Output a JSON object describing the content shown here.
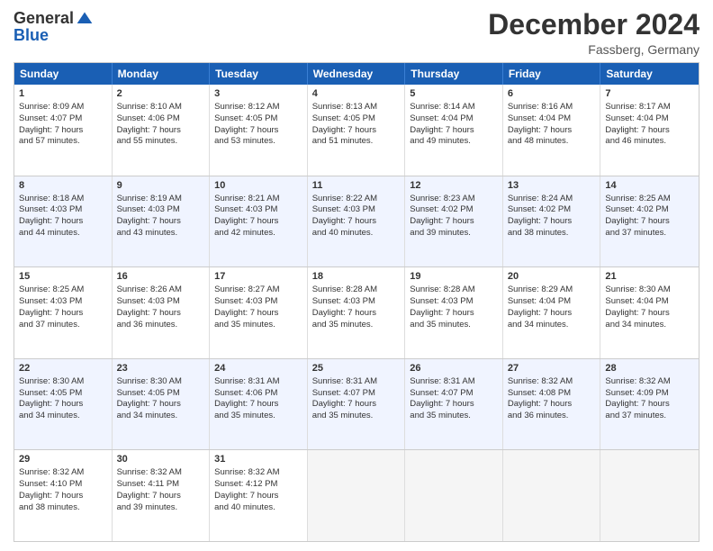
{
  "header": {
    "logo_general": "General",
    "logo_blue": "Blue",
    "month_title": "December 2024",
    "location": "Fassberg, Germany"
  },
  "weekdays": [
    "Sunday",
    "Monday",
    "Tuesday",
    "Wednesday",
    "Thursday",
    "Friday",
    "Saturday"
  ],
  "rows": [
    [
      {
        "day": "1",
        "lines": [
          "Sunrise: 8:09 AM",
          "Sunset: 4:07 PM",
          "Daylight: 7 hours",
          "and 57 minutes."
        ]
      },
      {
        "day": "2",
        "lines": [
          "Sunrise: 8:10 AM",
          "Sunset: 4:06 PM",
          "Daylight: 7 hours",
          "and 55 minutes."
        ]
      },
      {
        "day": "3",
        "lines": [
          "Sunrise: 8:12 AM",
          "Sunset: 4:05 PM",
          "Daylight: 7 hours",
          "and 53 minutes."
        ]
      },
      {
        "day": "4",
        "lines": [
          "Sunrise: 8:13 AM",
          "Sunset: 4:05 PM",
          "Daylight: 7 hours",
          "and 51 minutes."
        ]
      },
      {
        "day": "5",
        "lines": [
          "Sunrise: 8:14 AM",
          "Sunset: 4:04 PM",
          "Daylight: 7 hours",
          "and 49 minutes."
        ]
      },
      {
        "day": "6",
        "lines": [
          "Sunrise: 8:16 AM",
          "Sunset: 4:04 PM",
          "Daylight: 7 hours",
          "and 48 minutes."
        ]
      },
      {
        "day": "7",
        "lines": [
          "Sunrise: 8:17 AM",
          "Sunset: 4:04 PM",
          "Daylight: 7 hours",
          "and 46 minutes."
        ]
      }
    ],
    [
      {
        "day": "8",
        "lines": [
          "Sunrise: 8:18 AM",
          "Sunset: 4:03 PM",
          "Daylight: 7 hours",
          "and 44 minutes."
        ]
      },
      {
        "day": "9",
        "lines": [
          "Sunrise: 8:19 AM",
          "Sunset: 4:03 PM",
          "Daylight: 7 hours",
          "and 43 minutes."
        ]
      },
      {
        "day": "10",
        "lines": [
          "Sunrise: 8:21 AM",
          "Sunset: 4:03 PM",
          "Daylight: 7 hours",
          "and 42 minutes."
        ]
      },
      {
        "day": "11",
        "lines": [
          "Sunrise: 8:22 AM",
          "Sunset: 4:03 PM",
          "Daylight: 7 hours",
          "and 40 minutes."
        ]
      },
      {
        "day": "12",
        "lines": [
          "Sunrise: 8:23 AM",
          "Sunset: 4:02 PM",
          "Daylight: 7 hours",
          "and 39 minutes."
        ]
      },
      {
        "day": "13",
        "lines": [
          "Sunrise: 8:24 AM",
          "Sunset: 4:02 PM",
          "Daylight: 7 hours",
          "and 38 minutes."
        ]
      },
      {
        "day": "14",
        "lines": [
          "Sunrise: 8:25 AM",
          "Sunset: 4:02 PM",
          "Daylight: 7 hours",
          "and 37 minutes."
        ]
      }
    ],
    [
      {
        "day": "15",
        "lines": [
          "Sunrise: 8:25 AM",
          "Sunset: 4:03 PM",
          "Daylight: 7 hours",
          "and 37 minutes."
        ]
      },
      {
        "day": "16",
        "lines": [
          "Sunrise: 8:26 AM",
          "Sunset: 4:03 PM",
          "Daylight: 7 hours",
          "and 36 minutes."
        ]
      },
      {
        "day": "17",
        "lines": [
          "Sunrise: 8:27 AM",
          "Sunset: 4:03 PM",
          "Daylight: 7 hours",
          "and 35 minutes."
        ]
      },
      {
        "day": "18",
        "lines": [
          "Sunrise: 8:28 AM",
          "Sunset: 4:03 PM",
          "Daylight: 7 hours",
          "and 35 minutes."
        ]
      },
      {
        "day": "19",
        "lines": [
          "Sunrise: 8:28 AM",
          "Sunset: 4:03 PM",
          "Daylight: 7 hours",
          "and 35 minutes."
        ]
      },
      {
        "day": "20",
        "lines": [
          "Sunrise: 8:29 AM",
          "Sunset: 4:04 PM",
          "Daylight: 7 hours",
          "and 34 minutes."
        ]
      },
      {
        "day": "21",
        "lines": [
          "Sunrise: 8:30 AM",
          "Sunset: 4:04 PM",
          "Daylight: 7 hours",
          "and 34 minutes."
        ]
      }
    ],
    [
      {
        "day": "22",
        "lines": [
          "Sunrise: 8:30 AM",
          "Sunset: 4:05 PM",
          "Daylight: 7 hours",
          "and 34 minutes."
        ]
      },
      {
        "day": "23",
        "lines": [
          "Sunrise: 8:30 AM",
          "Sunset: 4:05 PM",
          "Daylight: 7 hours",
          "and 34 minutes."
        ]
      },
      {
        "day": "24",
        "lines": [
          "Sunrise: 8:31 AM",
          "Sunset: 4:06 PM",
          "Daylight: 7 hours",
          "and 35 minutes."
        ]
      },
      {
        "day": "25",
        "lines": [
          "Sunrise: 8:31 AM",
          "Sunset: 4:07 PM",
          "Daylight: 7 hours",
          "and 35 minutes."
        ]
      },
      {
        "day": "26",
        "lines": [
          "Sunrise: 8:31 AM",
          "Sunset: 4:07 PM",
          "Daylight: 7 hours",
          "and 35 minutes."
        ]
      },
      {
        "day": "27",
        "lines": [
          "Sunrise: 8:32 AM",
          "Sunset: 4:08 PM",
          "Daylight: 7 hours",
          "and 36 minutes."
        ]
      },
      {
        "day": "28",
        "lines": [
          "Sunrise: 8:32 AM",
          "Sunset: 4:09 PM",
          "Daylight: 7 hours",
          "and 37 minutes."
        ]
      }
    ],
    [
      {
        "day": "29",
        "lines": [
          "Sunrise: 8:32 AM",
          "Sunset: 4:10 PM",
          "Daylight: 7 hours",
          "and 38 minutes."
        ]
      },
      {
        "day": "30",
        "lines": [
          "Sunrise: 8:32 AM",
          "Sunset: 4:11 PM",
          "Daylight: 7 hours",
          "and 39 minutes."
        ]
      },
      {
        "day": "31",
        "lines": [
          "Sunrise: 8:32 AM",
          "Sunset: 4:12 PM",
          "Daylight: 7 hours",
          "and 40 minutes."
        ]
      },
      {
        "day": "",
        "lines": []
      },
      {
        "day": "",
        "lines": []
      },
      {
        "day": "",
        "lines": []
      },
      {
        "day": "",
        "lines": []
      }
    ]
  ]
}
